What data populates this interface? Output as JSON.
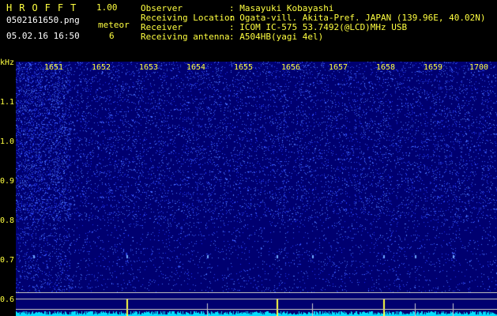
{
  "header": {
    "logo": "HROFFT",
    "version": "1.00",
    "filename": "0502161650.png",
    "datetime": "05.02.16 16:50",
    "meteor_label": "meteor",
    "meteor_count": "6"
  },
  "info": [
    {
      "label": "Observer",
      "value": ": Masayuki Kobayashi"
    },
    {
      "label": "Receiving Location",
      "value": ": Ogata-vill. Akita-Pref. JAPAN (139.96E, 40.02N)"
    },
    {
      "label": "Receiver",
      "value": ": ICOM IC-575 53.7492(@LCD)MHz USB"
    },
    {
      "label": "Receiving antenna",
      "value": ": A504HB(yagi 4el)"
    }
  ],
  "axis": {
    "y_unit": "kHz",
    "y_ticks": [
      "1.1",
      "1.0",
      "0.9",
      "0.8",
      "0.7",
      "0.6"
    ],
    "x_ticks": [
      "1651",
      "1652",
      "1653",
      "1654",
      "1655",
      "1656",
      "1657",
      "1658",
      "1659",
      "1700"
    ]
  },
  "colors": {
    "background": "#000000",
    "label": "#ffff40",
    "spectrogram": "#000070",
    "noise": "#4060ff",
    "baseline": "#00e0ff"
  }
}
